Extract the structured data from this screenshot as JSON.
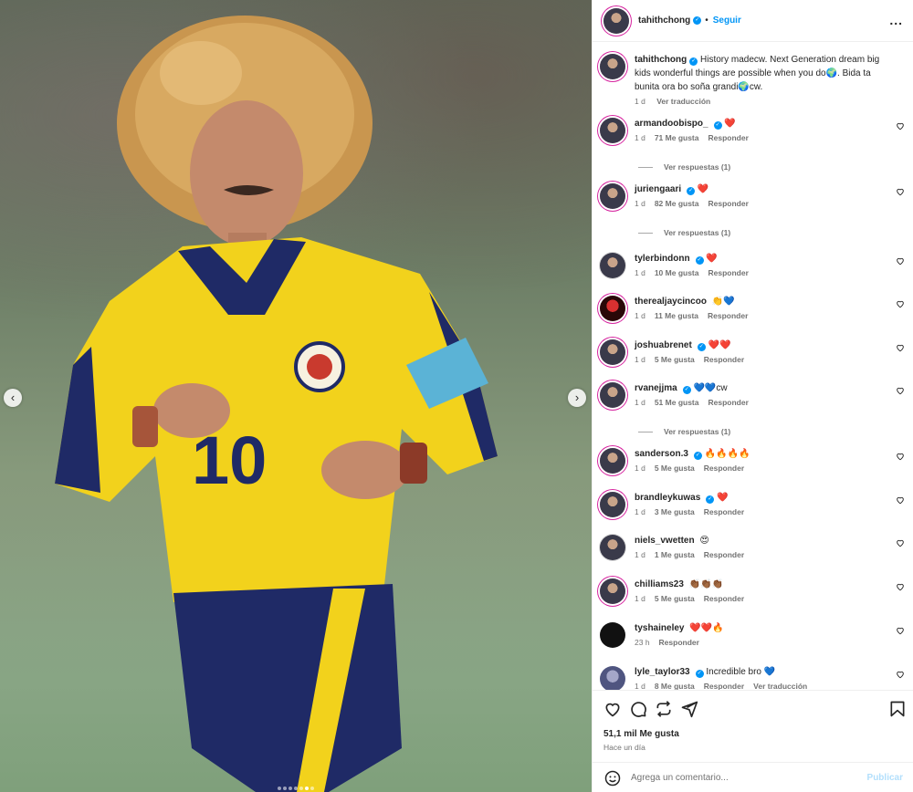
{
  "post": {
    "author": "tahithchong",
    "follow_label": "Seguir",
    "separator": "•",
    "more_label": "...",
    "caption": "History madecw. Next Generation dream big kids wonderful things are possible when you do🌍. Bida ta bunita ora bo soña grandi🌍cw.",
    "caption_time": "1 d",
    "translate_label": "Ver traducción"
  },
  "media": {
    "prev_icon": "chevron-left-icon",
    "next_icon": "chevron-right-icon",
    "dots_count": 7,
    "active_dot": 5,
    "jersey_number": "10"
  },
  "comments": [
    {
      "user": "armandoobispo_",
      "verified": true,
      "text": "❤️",
      "time": "1 d",
      "likes": "71 Me gusta",
      "reply": "Responder",
      "replies": "Ver respuestas (1)"
    },
    {
      "user": "juriengaari",
      "verified": true,
      "text": "❤️",
      "time": "1 d",
      "likes": "82 Me gusta",
      "reply": "Responder",
      "replies": "Ver respuestas (1)"
    },
    {
      "user": "tylerbindonn",
      "verified": true,
      "text": "❤️",
      "time": "1 d",
      "likes": "10 Me gusta",
      "reply": "Responder"
    },
    {
      "user": "therealjaycincoo",
      "verified": false,
      "text": "👏💙",
      "time": "1 d",
      "likes": "11 Me gusta",
      "reply": "Responder"
    },
    {
      "user": "joshuabrenet",
      "verified": true,
      "text": "❤️❤️",
      "time": "1 d",
      "likes": "5 Me gusta",
      "reply": "Responder"
    },
    {
      "user": "rvanejjma",
      "verified": true,
      "text": "💙💙cw",
      "time": "1 d",
      "likes": "51 Me gusta",
      "reply": "Responder",
      "replies": "Ver respuestas (1)"
    },
    {
      "user": "sanderson.3",
      "verified": true,
      "text": "🔥🔥🔥🔥",
      "time": "1 d",
      "likes": "5 Me gusta",
      "reply": "Responder"
    },
    {
      "user": "brandleykuwas",
      "verified": true,
      "text": "❤️",
      "time": "1 d",
      "likes": "3 Me gusta",
      "reply": "Responder"
    },
    {
      "user": "niels_vwetten",
      "verified": false,
      "text": "😍",
      "time": "1 d",
      "likes": "1 Me gusta",
      "reply": "Responder"
    },
    {
      "user": "chilliams23",
      "verified": false,
      "text": "👏🏾👏🏾👏🏾",
      "time": "1 d",
      "likes": "5 Me gusta",
      "reply": "Responder"
    },
    {
      "user": "tyshaineley",
      "verified": false,
      "text": "❤️❤️🔥",
      "time": "23 h",
      "likes": "",
      "reply": "Responder"
    },
    {
      "user": "lyle_taylor33",
      "verified": true,
      "text": "Incredible bro 💙",
      "time": "1 d",
      "likes": "8 Me gusta",
      "reply": "Responder",
      "translate": "Ver traducción"
    }
  ],
  "actions": {
    "like_icon": "heart-icon",
    "comment_icon": "comment-icon",
    "repost_icon": "repost-icon",
    "share_icon": "send-icon",
    "save_icon": "bookmark-icon",
    "likes_count": "51,1 mil Me gusta",
    "time_ago": "Hace un día"
  },
  "add_comment": {
    "placeholder": "Agrega un comentario...",
    "publish_label": "Publicar",
    "emoji_icon": "emoji-icon"
  },
  "colors": {
    "accent": "#0095f6",
    "publish_disabled": "#b2dffc",
    "story_ring": "#d6249f",
    "jersey_yellow": "#f2d21c",
    "jersey_navy": "#1f2a66"
  }
}
